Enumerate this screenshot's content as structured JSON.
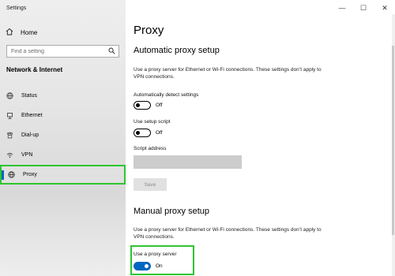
{
  "window": {
    "title": "Settings",
    "minimize": "—",
    "maximize": "☐",
    "close": "✕"
  },
  "sidebar": {
    "home_label": "Home",
    "search_placeholder": "Find a setting",
    "section_title": "Network & Internet",
    "items": [
      {
        "label": "Status",
        "icon": "globe-icon"
      },
      {
        "label": "Ethernet",
        "icon": "ethernet-icon"
      },
      {
        "label": "Dial-up",
        "icon": "phone-icon"
      },
      {
        "label": "VPN",
        "icon": "vpn-icon"
      },
      {
        "label": "Proxy",
        "icon": "globe-icon",
        "active": true
      }
    ]
  },
  "main": {
    "title": "Proxy",
    "automatic": {
      "heading": "Automatic proxy setup",
      "description": "Use a proxy server for Ethernet or Wi-Fi connections. These settings don’t apply to VPN connections.",
      "detect_label": "Automatically detect settings",
      "detect_state": "Off",
      "script_label": "Use setup script",
      "script_state": "Off",
      "address_label": "Script address",
      "address_value": "",
      "save_label": "Save"
    },
    "manual": {
      "heading": "Manual proxy setup",
      "description": "Use a proxy server for Ethernet or Wi-Fi connections. These settings don’t apply to VPN connections.",
      "use_proxy_label": "Use a proxy server",
      "use_proxy_state": "On"
    }
  },
  "colors": {
    "accent": "#0067c0",
    "highlight": "#2ec52e"
  }
}
